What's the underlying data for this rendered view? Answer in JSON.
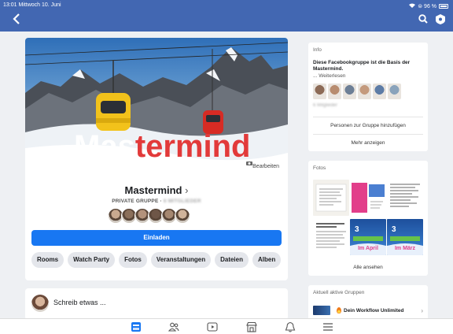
{
  "status_bar": {
    "time_date": "13:01  Mittwoch 10. Juni",
    "right": "⊜ 96 %"
  },
  "header": {
    "back_icon": "chevron-left-icon",
    "search_icon": "search-icon",
    "settings_icon": "shield-gear-icon"
  },
  "cover": {
    "title_part1": "Mas",
    "title_part2": "termind",
    "edit_label": "Bearbeiten"
  },
  "group": {
    "name": "Mastermind",
    "name_chevron": "›",
    "type": "PRIVATE GRUPPE ·",
    "members_blurred": "6 MITGLIEDER",
    "invite_label": "Einladen",
    "avatar_colors": [
      "#c9a98f",
      "#8b6f5a",
      "#b3927b",
      "#6e5647",
      "#a58770",
      "#d0b39a"
    ],
    "tabs": [
      "Rooms",
      "Watch Party",
      "Fotos",
      "Veranstaltungen",
      "Dateien",
      "Alben"
    ]
  },
  "composer": {
    "prompt": "Schreib etwas ..."
  },
  "info_card": {
    "heading": "Info",
    "description": "Diese Facebookgruppe ist die Basis der Mastermind.",
    "read_more": "... Weiterlesen",
    "members_blurred": "6 Mitglieder",
    "add_people": "Personen zur Gruppe hinzufügen",
    "show_more": "Mehr anzeigen",
    "thumb_colors": [
      "#8d6b57",
      "#b88c6f",
      "#6d7f96",
      "#c49a7d",
      "#5d7ca6",
      "#8aa3bb"
    ]
  },
  "photos_card": {
    "heading": "Fotos",
    "show_all": "Alle ansehen",
    "photo_captions": [
      "Im April",
      "Im März"
    ]
  },
  "active_groups": {
    "heading": "Aktuell aktive Gruppen",
    "item_name": "Dein Workflow Unlimited"
  },
  "tabbar": {
    "icons": [
      "home-icon",
      "people-icon",
      "watch-icon",
      "marketplace-icon",
      "bell-icon",
      "menu-icon"
    ]
  }
}
